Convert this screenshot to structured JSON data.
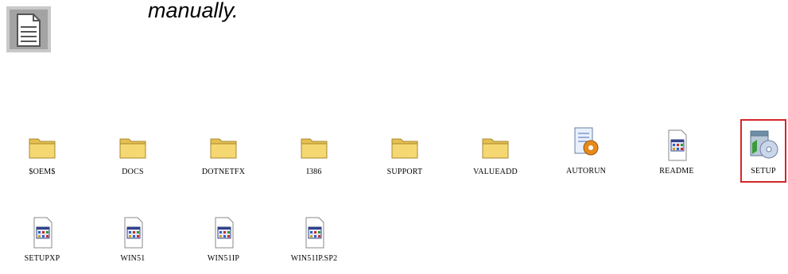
{
  "note": {
    "text": "manually.",
    "icon": "note-icon"
  },
  "files_row1": [
    {
      "name": "$OEM$",
      "icon": "folder-icon"
    },
    {
      "name": "DOCS",
      "icon": "folder-icon"
    },
    {
      "name": "DOTNETFX",
      "icon": "folder-icon"
    },
    {
      "name": "I386",
      "icon": "folder-icon"
    },
    {
      "name": "SUPPORT",
      "icon": "folder-icon"
    },
    {
      "name": "VALUEADD",
      "icon": "folder-icon"
    },
    {
      "name": "AUTORUN",
      "icon": "autorun-icon"
    },
    {
      "name": "README",
      "icon": "document-icon"
    },
    {
      "name": "SETUP",
      "icon": "setup-icon",
      "highlighted": true
    }
  ],
  "files_row2": [
    {
      "name": "SETUPXP",
      "icon": "document-icon"
    },
    {
      "name": "WIN51",
      "icon": "document-icon"
    },
    {
      "name": "WIN51IP",
      "icon": "document-icon"
    },
    {
      "name": "WIN51IP.SP2",
      "icon": "document-icon"
    }
  ],
  "colors": {
    "highlight": "#d6262a",
    "folder": "#f6d873"
  }
}
